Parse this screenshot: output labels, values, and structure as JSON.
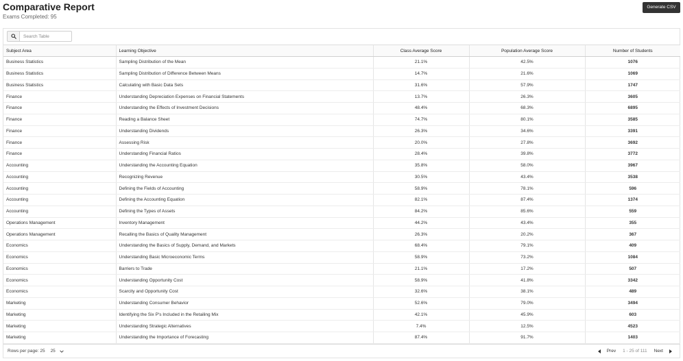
{
  "header": {
    "title": "Comparative Report",
    "subtitle": "Exams Completed: 95",
    "csv_button": "Generate CSV"
  },
  "search": {
    "placeholder": "Search Table",
    "icon": "search-icon"
  },
  "table": {
    "columns": [
      "Subject Area",
      "Learning Objective",
      "Class Average Score",
      "Population Average Score",
      "Number of Students"
    ],
    "rows": [
      [
        "Business Statistics",
        "Sampling Distribution of the Mean",
        "21.1%",
        "42.5%",
        "1076"
      ],
      [
        "Business Statistics",
        "Sampling Distribution of Difference Between Means",
        "14.7%",
        "21.6%",
        "1069"
      ],
      [
        "Business Statistics",
        "Calculating with Basic Data Sets",
        "31.6%",
        "57.9%",
        "1747"
      ],
      [
        "Finance",
        "Understanding Depreciation Expenses on Financial Statements",
        "13.7%",
        "26.3%",
        "3605"
      ],
      [
        "Finance",
        "Understanding the Effects of Investment Decisions",
        "48.4%",
        "68.3%",
        "6895"
      ],
      [
        "Finance",
        "Reading a Balance Sheet",
        "74.7%",
        "80.1%",
        "3585"
      ],
      [
        "Finance",
        "Understanding Dividends",
        "26.3%",
        "34.6%",
        "3391"
      ],
      [
        "Finance",
        "Assessing Risk",
        "20.0%",
        "27.8%",
        "3692"
      ],
      [
        "Finance",
        "Understanding Financial Ratios",
        "28.4%",
        "39.8%",
        "3772"
      ],
      [
        "Accounting",
        "Understanding the Accounting Equation",
        "35.8%",
        "58.0%",
        "3967"
      ],
      [
        "Accounting",
        "Recognizing Revenue",
        "30.5%",
        "43.4%",
        "3538"
      ],
      [
        "Accounting",
        "Defining the Fields of Accounting",
        "58.9%",
        "78.1%",
        "596"
      ],
      [
        "Accounting",
        "Defining the Accounting Equation",
        "82.1%",
        "87.4%",
        "1374"
      ],
      [
        "Accounting",
        "Defining the Types of Assets",
        "84.2%",
        "85.6%",
        "559"
      ],
      [
        "Operations Management",
        "Inventory Management",
        "44.2%",
        "43.4%",
        "355"
      ],
      [
        "Operations Management",
        "Recalling the Basics of Quality Management",
        "26.3%",
        "20.2%",
        "367"
      ],
      [
        "Economics",
        "Understanding the Basics of Supply, Demand, and Markets",
        "68.4%",
        "79.1%",
        "409"
      ],
      [
        "Economics",
        "Understanding Basic Microeconomic Terms",
        "58.9%",
        "73.2%",
        "1084"
      ],
      [
        "Economics",
        "Barriers to Trade",
        "21.1%",
        "17.2%",
        "507"
      ],
      [
        "Economics",
        "Understanding Opportunity Cost",
        "58.9%",
        "41.8%",
        "3342"
      ],
      [
        "Economics",
        "Scarcity and Opportunity Cost",
        "32.6%",
        "38.1%",
        "489"
      ],
      [
        "Marketing",
        "Understanding Consumer Behavior",
        "52.6%",
        "79.0%",
        "3494"
      ],
      [
        "Marketing",
        "Identifying the Six P's Included in the Retailing Mix",
        "42.1%",
        "45.9%",
        "603"
      ],
      [
        "Marketing",
        "Understanding Strategic Alternatives",
        "7.4%",
        "12.5%",
        "4523"
      ],
      [
        "Marketing",
        "Understanding the Importance of Forecasting",
        "87.4%",
        "91.7%",
        "1403"
      ]
    ]
  },
  "footer": {
    "rows_per_page_label": "Rows per page: 25",
    "rows_per_page_value": "25",
    "prev_label": "Prev",
    "range": "1 - 25 of 111",
    "next_label": "Next"
  }
}
